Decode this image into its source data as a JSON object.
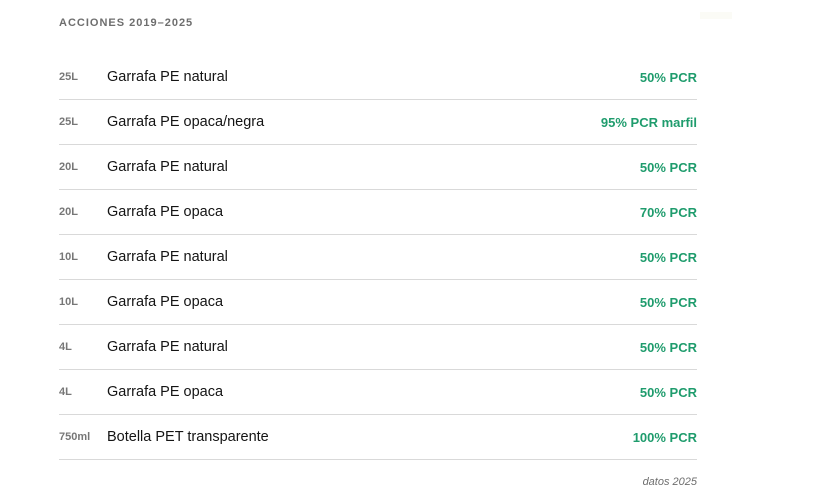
{
  "header": {
    "title": "ACCIONES 2019–2025"
  },
  "rows": [
    {
      "size": "25L",
      "product": "Garrafa PE natural",
      "pcr": "50% PCR"
    },
    {
      "size": "25L",
      "product": "Garrafa PE opaca/negra",
      "pcr": "95% PCR marfil"
    },
    {
      "size": "20L",
      "product": "Garrafa PE natural",
      "pcr": "50% PCR"
    },
    {
      "size": "20L",
      "product": "Garrafa PE opaca",
      "pcr": "70% PCR"
    },
    {
      "size": "10L",
      "product": "Garrafa PE natural",
      "pcr": "50% PCR"
    },
    {
      "size": "10L",
      "product": "Garrafa PE opaca",
      "pcr": "50% PCR"
    },
    {
      "size": "4L",
      "product": "Garrafa PE natural",
      "pcr": "50% PCR"
    },
    {
      "size": "4L",
      "product": "Garrafa PE opaca",
      "pcr": "50% PCR"
    },
    {
      "size": "750ml",
      "product": "Botella PET transparente",
      "pcr": "100% PCR"
    }
  ],
  "footer": {
    "note": "datos 2025"
  },
  "colors": {
    "accent": "#1f9c6d",
    "muted": "#777777",
    "divider": "#d9d9d9"
  }
}
